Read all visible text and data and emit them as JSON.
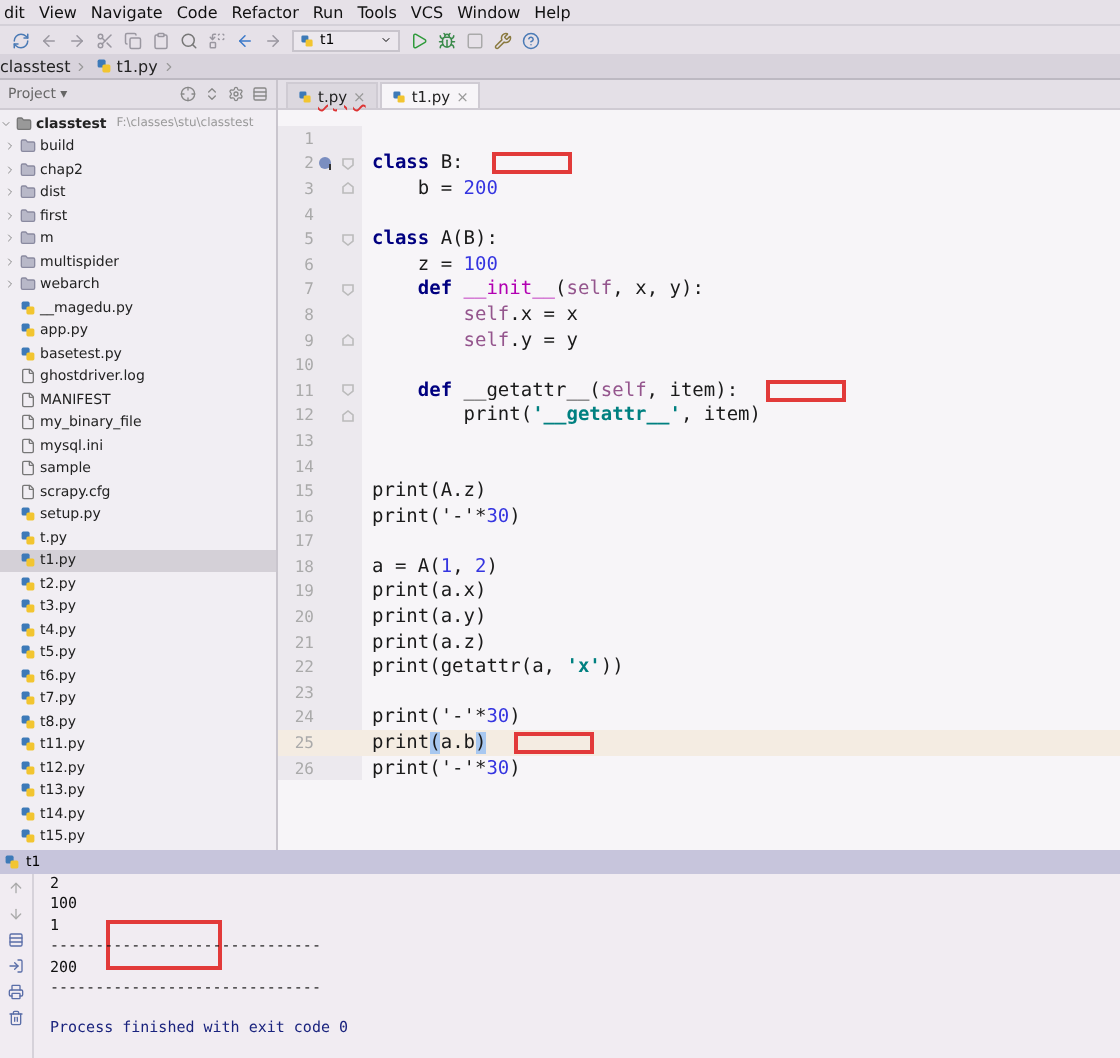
{
  "menu": [
    "dit",
    "View",
    "Navigate",
    "Code",
    "Refactor",
    "Run",
    "Tools",
    "VCS",
    "Window",
    "Help"
  ],
  "toolbar": {
    "run_config": "t1"
  },
  "breadcrumb": [
    "classtest",
    "t1.py"
  ],
  "project_panel": {
    "title": "Project ▾",
    "tree": {
      "label": "classtest",
      "path": "F:\\classes\\stu\\classtest",
      "kind": "root",
      "expanded": true,
      "selected": false,
      "children": [
        {
          "label": "build",
          "kind": "folder",
          "expanded": false,
          "selected": false
        },
        {
          "label": "chap2",
          "kind": "folder",
          "expanded": false,
          "selected": false
        },
        {
          "label": "dist",
          "kind": "folder",
          "expanded": false,
          "selected": false
        },
        {
          "label": "first",
          "kind": "folder",
          "expanded": false,
          "selected": false
        },
        {
          "label": "m",
          "kind": "folder",
          "expanded": false,
          "selected": false
        },
        {
          "label": "multispider",
          "kind": "folder",
          "expanded": false,
          "selected": false
        },
        {
          "label": "webarch",
          "kind": "folder",
          "expanded": false,
          "selected": false
        },
        {
          "label": "__magedu.py",
          "kind": "python",
          "selected": false
        },
        {
          "label": "app.py",
          "kind": "python",
          "selected": false
        },
        {
          "label": "basetest.py",
          "kind": "python",
          "selected": false
        },
        {
          "label": "ghostdriver.log",
          "kind": "file",
          "selected": false
        },
        {
          "label": "MANIFEST",
          "kind": "file",
          "selected": false
        },
        {
          "label": "my_binary_file",
          "kind": "file",
          "selected": false
        },
        {
          "label": "mysql.ini",
          "kind": "file",
          "selected": false
        },
        {
          "label": "sample",
          "kind": "file",
          "selected": false
        },
        {
          "label": "scrapy.cfg",
          "kind": "file",
          "selected": false
        },
        {
          "label": "setup.py",
          "kind": "python",
          "selected": false
        },
        {
          "label": "t.py",
          "kind": "python",
          "selected": false
        },
        {
          "label": "t1.py",
          "kind": "python",
          "selected": true
        },
        {
          "label": "t2.py",
          "kind": "python",
          "selected": false
        },
        {
          "label": "t3.py",
          "kind": "python",
          "selected": false
        },
        {
          "label": "t4.py",
          "kind": "python",
          "selected": false
        },
        {
          "label": "t5.py",
          "kind": "python",
          "selected": false
        },
        {
          "label": "t6.py",
          "kind": "python",
          "selected": false
        },
        {
          "label": "t7.py",
          "kind": "python",
          "selected": false
        },
        {
          "label": "t8.py",
          "kind": "python",
          "selected": false
        },
        {
          "label": "t11.py",
          "kind": "python",
          "selected": false
        },
        {
          "label": "t12.py",
          "kind": "python",
          "selected": false
        },
        {
          "label": "t13.py",
          "kind": "python",
          "selected": false
        },
        {
          "label": "t14.py",
          "kind": "python",
          "selected": false
        },
        {
          "label": "t15.py",
          "kind": "python",
          "selected": false
        }
      ]
    }
  },
  "tabs": [
    {
      "label": "t.py",
      "close": "×",
      "selected": false
    },
    {
      "label": "t1.py",
      "close": "×",
      "selected": true
    }
  ],
  "editor": {
    "lines": [
      {
        "number": "1",
        "current": false,
        "marked": false
      },
      {
        "number": "2",
        "tokens": [
          {
            "kind": "kw",
            "text": "class"
          },
          {
            "kind": "plain",
            "text": " B:"
          }
        ],
        "fold_open": true,
        "override": true,
        "current": false,
        "marked": true
      },
      {
        "number": "3",
        "tokens": [
          {
            "kind": "plain",
            "text": "    b = "
          },
          {
            "kind": "num",
            "text": "200"
          }
        ],
        "fold_close": true,
        "current": false,
        "marked": false
      },
      {
        "number": "4",
        "current": false,
        "marked": false
      },
      {
        "number": "5",
        "tokens": [
          {
            "kind": "kw",
            "text": "class"
          },
          {
            "kind": "plain",
            "text": " A(B):"
          }
        ],
        "fold_open": true,
        "current": false,
        "marked": false
      },
      {
        "number": "6",
        "tokens": [
          {
            "kind": "plain",
            "text": "    z = "
          },
          {
            "kind": "num",
            "text": "100"
          }
        ],
        "current": false,
        "marked": false
      },
      {
        "number": "7",
        "tokens": [
          {
            "kind": "kw",
            "text": "    def"
          },
          {
            "kind": "magic",
            "text": " __init__"
          },
          {
            "kind": "plain",
            "text": "("
          },
          {
            "kind": "self",
            "text": "self"
          },
          {
            "kind": "plain",
            "text": ", x, y):"
          }
        ],
        "fold_open": true,
        "current": false,
        "marked": false
      },
      {
        "number": "8",
        "tokens": [
          {
            "kind": "self",
            "text": "        self"
          },
          {
            "kind": "plain",
            "text": ".x = x"
          }
        ],
        "current": false,
        "marked": false
      },
      {
        "number": "9",
        "tokens": [
          {
            "kind": "self",
            "text": "        self"
          },
          {
            "kind": "plain",
            "text": ".y = y"
          }
        ],
        "fold_close": true,
        "current": false,
        "marked": false
      },
      {
        "number": "10",
        "current": false,
        "marked": false
      },
      {
        "number": "11",
        "tokens": [
          {
            "kind": "kw",
            "text": "    def"
          },
          {
            "kind": "plain",
            "text": " __getattr__("
          },
          {
            "kind": "self",
            "text": "self"
          },
          {
            "kind": "plain",
            "text": ", item):"
          }
        ],
        "fold_open": true,
        "current": false,
        "marked": true
      },
      {
        "number": "12",
        "tokens": [
          {
            "kind": "plain",
            "text": "        print("
          },
          {
            "kind": "str",
            "text": "'__getattr__'"
          },
          {
            "kind": "plain",
            "text": ", item)"
          }
        ],
        "fold_close": true,
        "current": false,
        "marked": false
      },
      {
        "number": "13",
        "current": false,
        "marked": false
      },
      {
        "number": "14",
        "current": false,
        "marked": false
      },
      {
        "number": "15",
        "tokens": [
          {
            "kind": "plain",
            "text": "print(A.z)"
          }
        ],
        "current": false,
        "marked": false
      },
      {
        "number": "16",
        "tokens": [
          {
            "kind": "plain",
            "text": "print('-'*"
          },
          {
            "kind": "num",
            "text": "30"
          },
          {
            "kind": "plain",
            "text": ")"
          }
        ],
        "current": false,
        "marked": false
      },
      {
        "number": "17",
        "current": false,
        "marked": false
      },
      {
        "number": "18",
        "tokens": [
          {
            "kind": "plain",
            "text": "a = A("
          },
          {
            "kind": "num",
            "text": "1"
          },
          {
            "kind": "plain",
            "text": ", "
          },
          {
            "kind": "num",
            "text": "2"
          },
          {
            "kind": "plain",
            "text": ")"
          }
        ],
        "current": false,
        "marked": false
      },
      {
        "number": "19",
        "tokens": [
          {
            "kind": "plain",
            "text": "print(a.x)"
          }
        ],
        "current": false,
        "marked": false
      },
      {
        "number": "20",
        "tokens": [
          {
            "kind": "plain",
            "text": "print(a.y)"
          }
        ],
        "current": false,
        "marked": false
      },
      {
        "number": "21",
        "tokens": [
          {
            "kind": "plain",
            "text": "print(a.z)"
          }
        ],
        "current": false,
        "marked": false
      },
      {
        "number": "22",
        "tokens": [
          {
            "kind": "plain",
            "text": "print(getattr(a, "
          },
          {
            "kind": "str",
            "text": "'x'"
          },
          {
            "kind": "plain",
            "text": "))"
          }
        ],
        "current": false,
        "marked": false
      },
      {
        "number": "23",
        "current": false,
        "marked": false
      },
      {
        "number": "24",
        "tokens": [
          {
            "kind": "plain",
            "text": "print('-'*"
          },
          {
            "kind": "num",
            "text": "30"
          },
          {
            "kind": "plain",
            "text": ")"
          }
        ],
        "current": false,
        "marked": false
      },
      {
        "number": "25",
        "tokens": [
          {
            "kind": "plain",
            "text": "print"
          },
          {
            "kind": "brace",
            "text": "("
          },
          {
            "kind": "plain",
            "text": "a.b"
          },
          {
            "kind": "brace",
            "text": ")"
          }
        ],
        "current": true,
        "marked": true
      },
      {
        "number": "26",
        "tokens": [
          {
            "kind": "plain",
            "text": "print('-'*"
          },
          {
            "kind": "num",
            "text": "30"
          },
          {
            "kind": "plain",
            "text": ")"
          }
        ],
        "current": false,
        "marked": false
      }
    ]
  },
  "run_panel": {
    "title": "t1",
    "output": [
      {
        "text": "2",
        "kind": "out",
        "marked": false
      },
      {
        "text": "100",
        "kind": "out",
        "marked": false
      },
      {
        "text": "1",
        "kind": "out",
        "marked": false
      },
      {
        "text": "------------------------------",
        "kind": "out",
        "marked": true
      },
      {
        "text": "200",
        "kind": "out",
        "marked": false
      },
      {
        "text": "------------------------------",
        "kind": "out",
        "marked": false
      },
      {
        "text": "Process finished with exit code 0",
        "kind": "system",
        "marked": false
      }
    ]
  }
}
